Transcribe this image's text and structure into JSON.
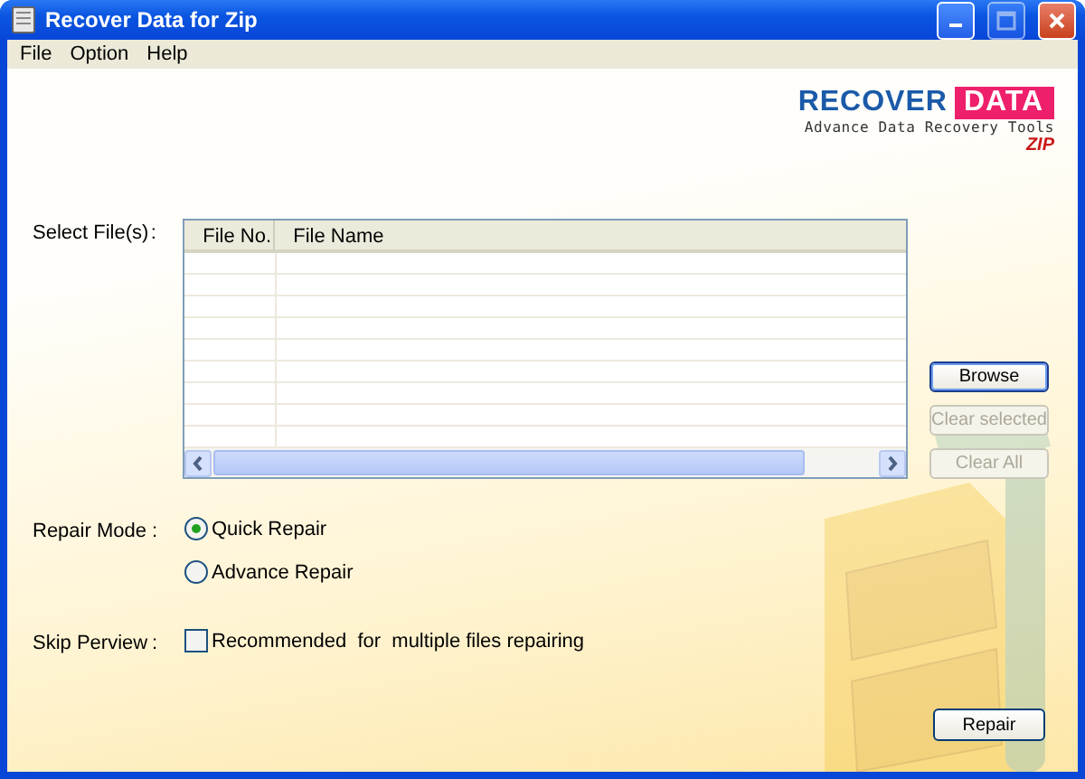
{
  "window": {
    "title": "Recover Data for Zip"
  },
  "menu": [
    "File",
    "Option",
    "Help"
  ],
  "logo": {
    "brand_left": "RECOVER",
    "brand_right": "DATA",
    "tagline": "Advance Data Recovery Tools",
    "product": "ZIP"
  },
  "file_select": {
    "label": "Select File(s)",
    "separator": ":",
    "columns": [
      "File No.",
      "File Name"
    ]
  },
  "buttons": [
    {
      "label": "Browse",
      "disabled": false,
      "focused": true
    },
    {
      "label": "Clear selected",
      "disabled": true,
      "focused": false
    },
    {
      "label": "Clear All",
      "disabled": true,
      "focused": false
    }
  ],
  "repair_mode": {
    "label": "Repair Mode",
    "separator": ":",
    "options": [
      {
        "label": "Quick Repair",
        "selected": true
      },
      {
        "label": "Advance Repair",
        "selected": false
      }
    ]
  },
  "skip_preview": {
    "label": "Skip Perview",
    "separator": ":",
    "option": {
      "label": "Recommended  for  multiple files repairing",
      "checked": false
    }
  },
  "repair_button": {
    "label": "Repair",
    "disabled": false
  }
}
